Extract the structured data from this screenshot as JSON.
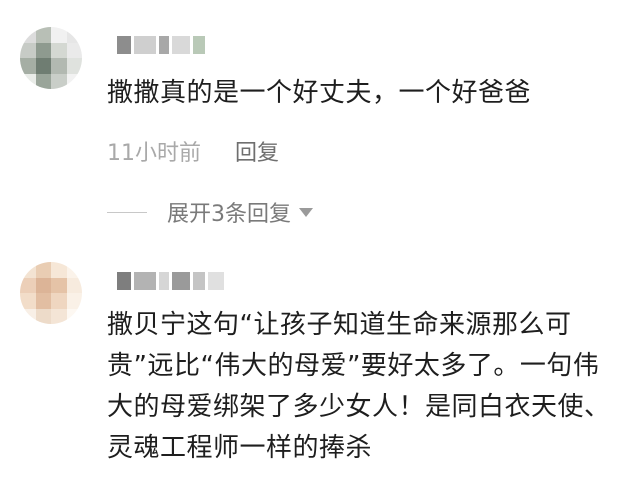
{
  "comments": [
    {
      "username": "",
      "avatar_colors": [
        "#dcdcdc",
        "#b8bfb6",
        "#f1f1f1",
        "#e6e6e6",
        "#c7cbc6",
        "#8e9a8f",
        "#d4d8d2",
        "#eaeaea",
        "#a5aea4",
        "#6f7d72",
        "#b2b9b1",
        "#dfe2de",
        "#e9ece8",
        "#9aa59a",
        "#c9cec8",
        "#f2f2f2"
      ],
      "username_blocks": [
        "#8d8d8d",
        "#cfcfcf",
        "#a8a8a8",
        "#d9d9d9",
        "#b9c9b7"
      ],
      "text": "撒撒真的是一个好丈夫，一个好爸爸",
      "time": "11小时前",
      "reply_label": "回复",
      "expand_label": "展开3条回复"
    },
    {
      "username": "",
      "avatar_colors": [
        "#f3e3d2",
        "#e9cdb3",
        "#f6e7d7",
        "#fbf3ea",
        "#eccfb8",
        "#dcb497",
        "#e5c3a7",
        "#f7ebde",
        "#f2ddc9",
        "#e2bea2",
        "#efd6c0",
        "#faf1e7",
        "#f8efe6",
        "#eddbc9",
        "#f4e5d6",
        "#fdf8f2"
      ],
      "username_blocks": [
        "#7e7e7e",
        "#b3b3b3",
        "#d6d6d6",
        "#9a9a9a",
        "#c4c4c4",
        "#e0e0e0"
      ],
      "text": "撒贝宁这句“让孩子知道生命来源那么可贵”远比“伟大的母爱”要好太多了。一句伟大的母爱绑架了多少女人！是同白衣天使、灵魂工程师一样的捧杀"
    }
  ]
}
